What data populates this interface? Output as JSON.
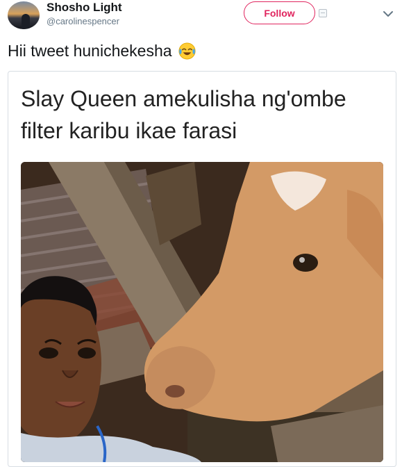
{
  "user": {
    "display_name": "Shosho Light",
    "handle": "@carolinespencer",
    "avatar_icon": "sunset-silhouette-avatar"
  },
  "header": {
    "follow_label": "Follow",
    "follow_color": "#e0245e",
    "blocked_icon": "envelope-icon",
    "more_icon": "chevron-down-icon"
  },
  "tweet": {
    "text": "Hii tweet hunichekesha",
    "emoji": "face-with-tears-of-joy-icon"
  },
  "card": {
    "caption": "Slay Queen amekulisha ng'ombe filter karibu ikae farasi",
    "image": "selfie-woman-with-cow-photo"
  }
}
